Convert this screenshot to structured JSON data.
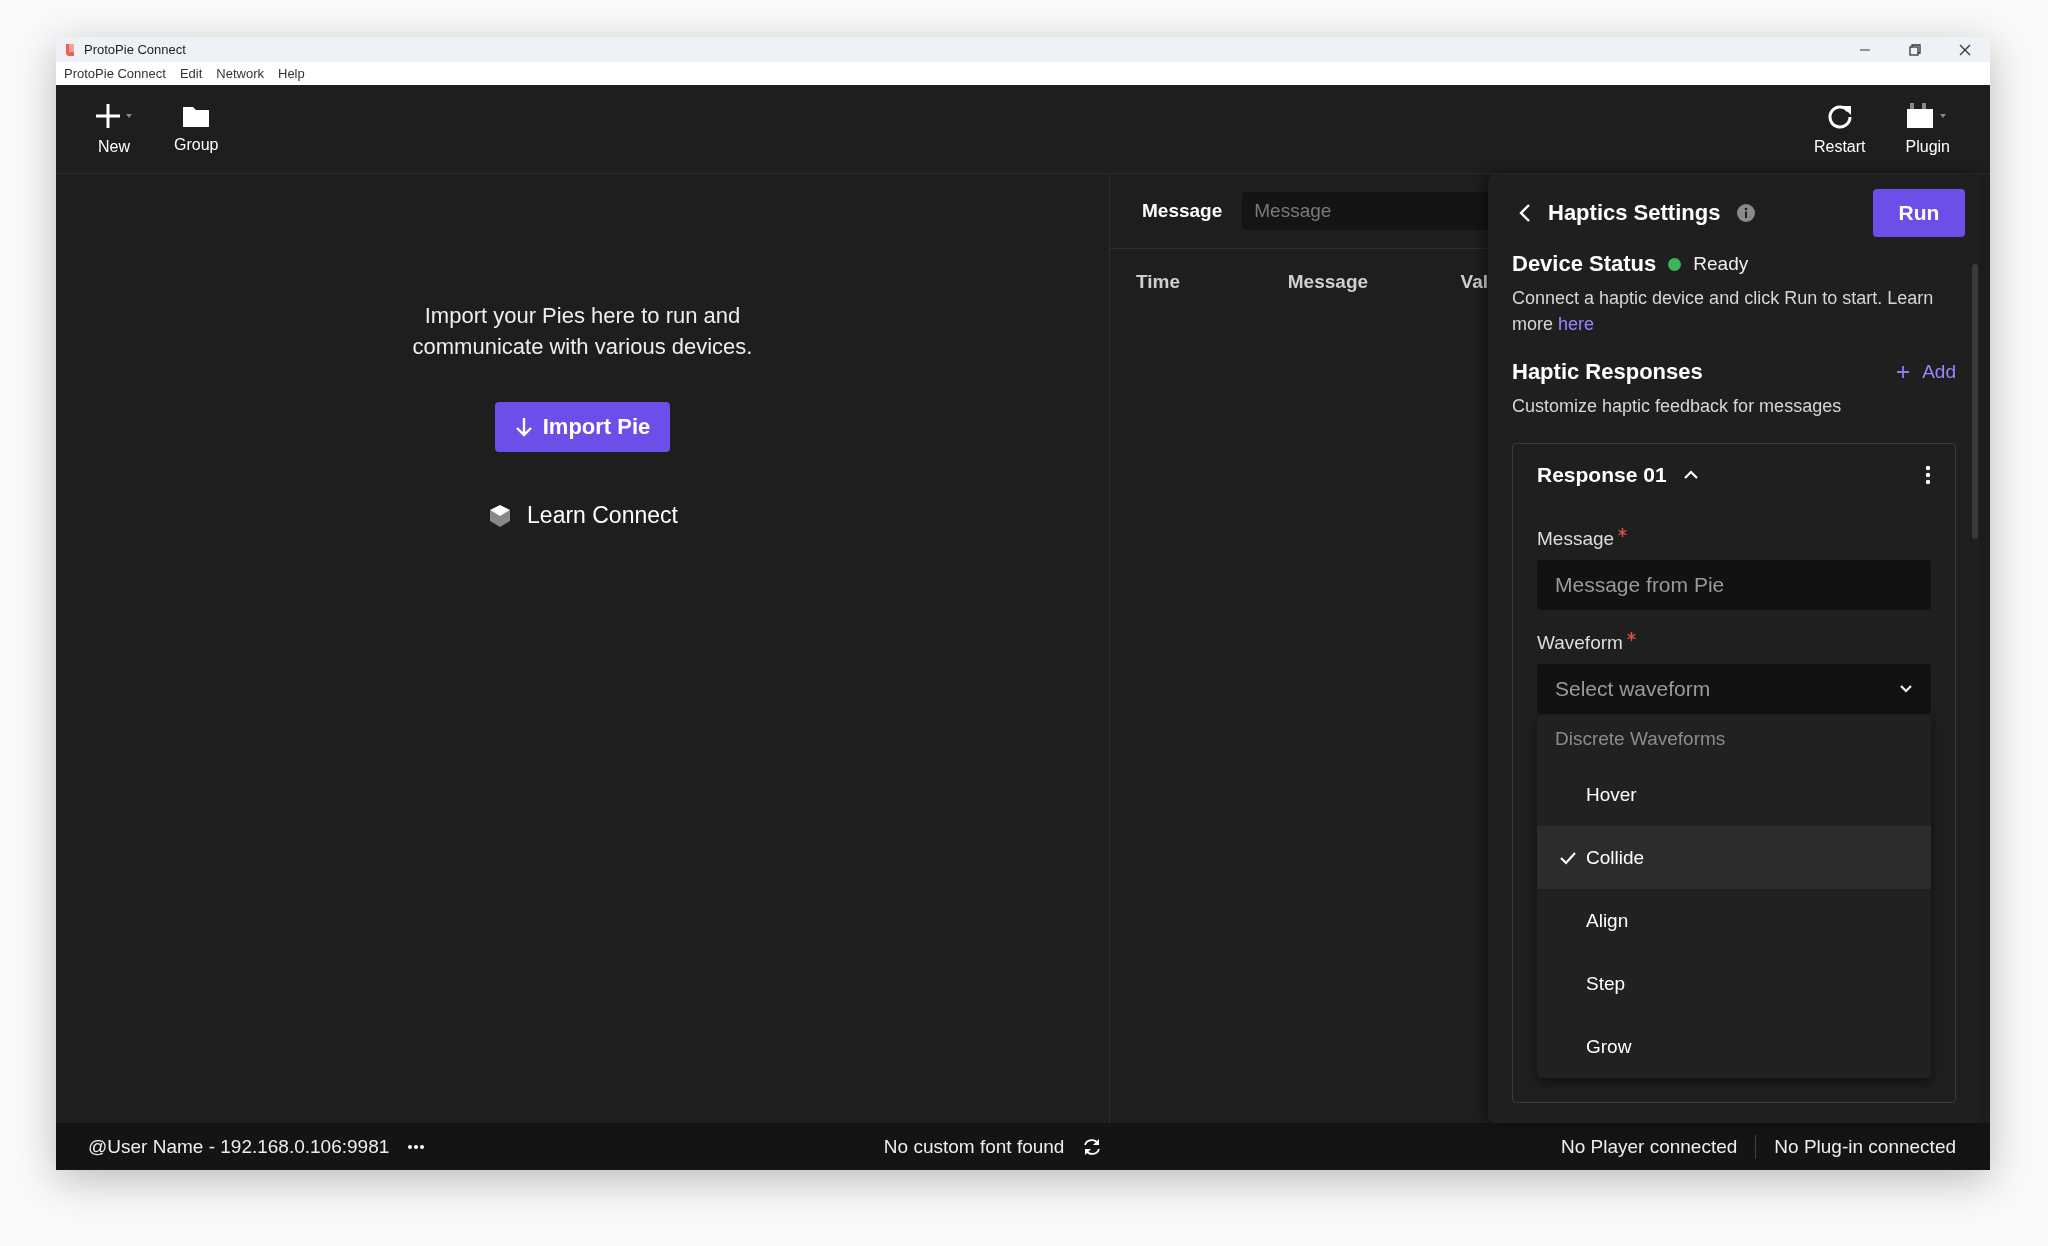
{
  "window": {
    "title": "ProtoPie Connect"
  },
  "menu": [
    "ProtoPie Connect",
    "Edit",
    "Network",
    "Help"
  ],
  "toolbar_left": [
    {
      "kind": "new",
      "label": "New"
    },
    {
      "kind": "group",
      "label": "Group"
    }
  ],
  "toolbar_right": [
    {
      "kind": "restart",
      "label": "Restart"
    },
    {
      "kind": "plugin",
      "label": "Plugin"
    }
  ],
  "empty_state": {
    "text": "Import your Pies here to run and communicate with various devices.",
    "button": "Import Pie",
    "link": "Learn Connect"
  },
  "message_log": {
    "filter_label": "Message",
    "filter": {
      "placeholder": "Message"
    },
    "columns": [
      "Time",
      "Message",
      "Val"
    ]
  },
  "haptics": {
    "title": "Haptics Settings",
    "run_button": "Run",
    "device_status": {
      "heading": "Device Status",
      "status": "Ready",
      "text": "Connect a haptic device and click Run to start. Learn more",
      "link": "here"
    },
    "responses": {
      "heading": "Haptic Responses",
      "add": "Add",
      "text": "Customize haptic feedback for messages"
    },
    "response": {
      "title": "Response 01",
      "expanded": true,
      "fields": [
        {
          "kind": "input",
          "label": "Message",
          "required": true,
          "placeholder": "Message from Pie"
        },
        {
          "kind": "select",
          "label": "Waveform",
          "required": true,
          "placeholder": "Select waveform"
        }
      ],
      "dropdown": {
        "group": "Discrete Waveforms",
        "options": [
          {
            "label": "Hover",
            "selected": false
          },
          {
            "label": "Collide",
            "selected": true
          },
          {
            "label": "Align",
            "selected": false
          },
          {
            "label": "Step",
            "selected": false
          },
          {
            "label": "Grow",
            "selected": false
          }
        ]
      }
    }
  },
  "status_bar": {
    "user": "@User Name - 192.168.0.106:9981",
    "font": "No custom font found",
    "player": "No Player connected",
    "plugin": "No Plug-in connected"
  }
}
